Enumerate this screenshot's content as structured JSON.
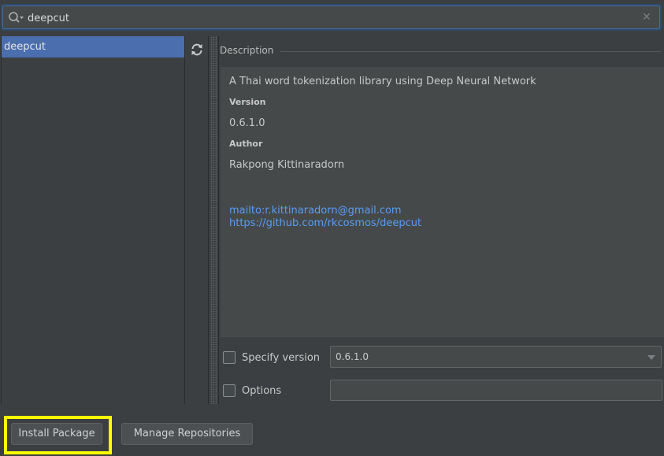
{
  "search": {
    "value": "deepcut",
    "icons": {
      "search": "search-icon",
      "clear": "close-icon"
    }
  },
  "packages": {
    "items": [
      {
        "label": "deepcut",
        "selected": true
      }
    ],
    "refresh_icon": "refresh-icon"
  },
  "description": {
    "header": "Description",
    "summary": "A Thai word tokenization library using Deep Neural Network",
    "version_label": "Version",
    "version_value": "0.6.1.0",
    "author_label": "Author",
    "author_value": "Rakpong Kittinaradorn",
    "links": [
      "mailto:r.kittinaradorn@gmail.com",
      "https://github.com/rkcosmos/deepcut"
    ]
  },
  "options": {
    "specify_version_label": "Specify version",
    "specify_version_checked": false,
    "version_selected": "0.6.1.0",
    "options_label": "Options",
    "options_checked": false,
    "options_value": ""
  },
  "buttons": {
    "install": "Install Package",
    "manage": "Manage Repositories"
  },
  "colors": {
    "background": "#3c3f41",
    "selection": "#4b6eaf",
    "link": "#589df6",
    "highlight": "#ffff00"
  }
}
